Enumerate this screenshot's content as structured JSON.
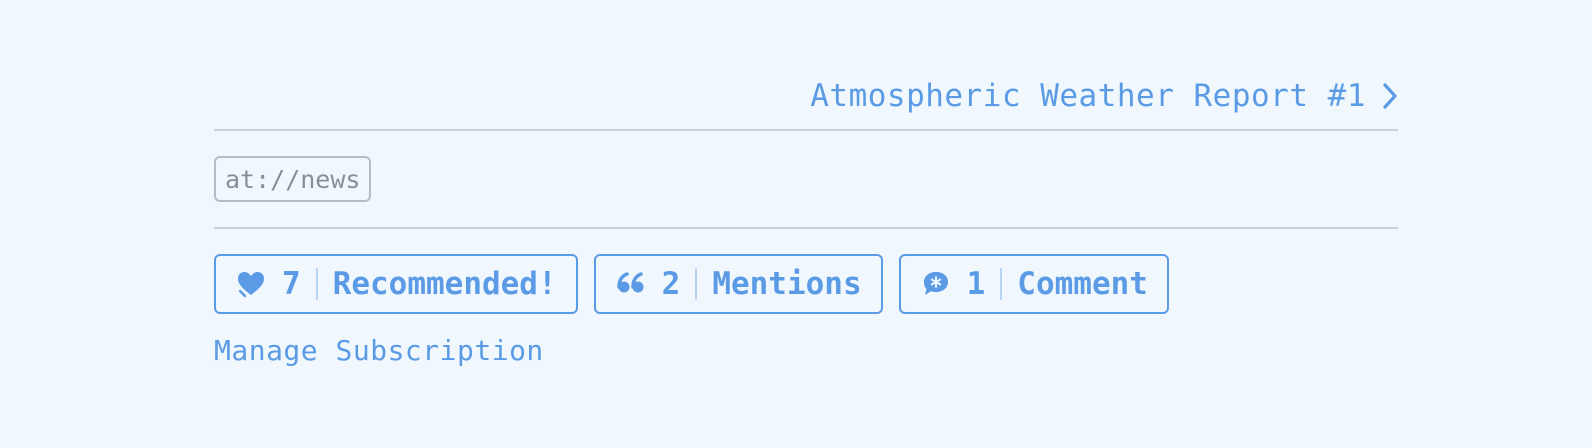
{
  "header": {
    "next_post_label": "Atmospheric Weather Report #1",
    "next_icon": "chevron-right-icon"
  },
  "tag": {
    "label": "at://news"
  },
  "reactions": [
    {
      "name": "recommend",
      "icon": "heart-icon",
      "count": "7",
      "label": "Recommended!"
    },
    {
      "name": "mentions",
      "icon": "quote-icon",
      "count": "2",
      "label": "Mentions"
    },
    {
      "name": "comments",
      "icon": "comment-bubble-icon",
      "count": "1",
      "label": "Comment"
    }
  ],
  "footer": {
    "manage_label": "Manage Subscription"
  },
  "colors": {
    "background": "#f1f8fd",
    "accent": "#5b9be6",
    "divider": "#c9d2d8",
    "tag_border": "#b7bcc1",
    "tag_text": "#8a8f94"
  }
}
